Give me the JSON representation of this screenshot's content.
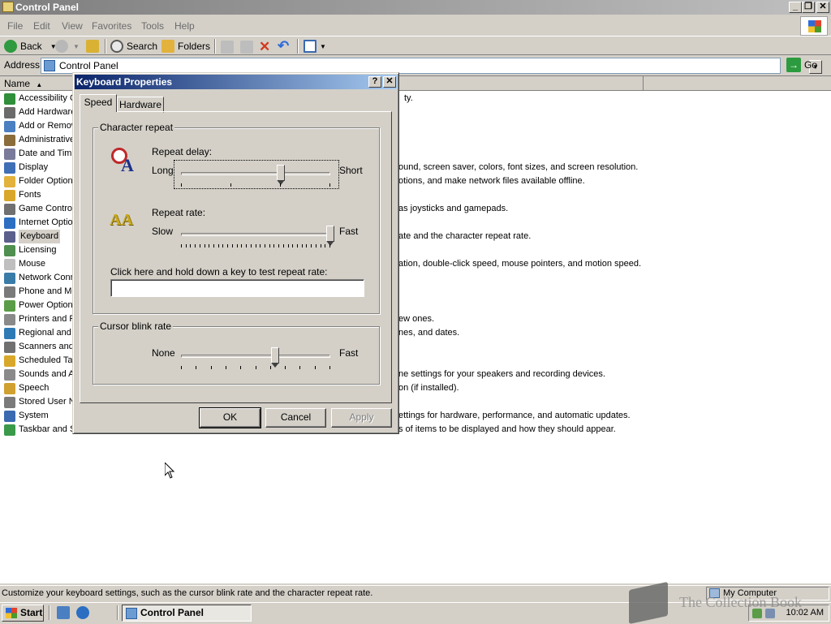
{
  "window": {
    "title": "Control Panel",
    "controls": {
      "minimize": "_",
      "maximize": "❐",
      "close": "✕"
    }
  },
  "menubar": [
    "File",
    "Edit",
    "View",
    "Favorites",
    "Tools",
    "Help"
  ],
  "toolbar": {
    "back": "Back",
    "search": "Search",
    "folders": "Folders"
  },
  "address": {
    "label": "Address",
    "value": "Control Panel",
    "go": "Go"
  },
  "columns": {
    "name": "Name"
  },
  "items": [
    {
      "label": "Accessibility O",
      "color": "#2f8f3a"
    },
    {
      "label": "Add Hardware",
      "color": "#6b6b6b"
    },
    {
      "label": "Add or Remov",
      "color": "#4a7fc1"
    },
    {
      "label": "Administrative",
      "color": "#8a6d3b"
    },
    {
      "label": "Date and Tim",
      "color": "#7a7a9a"
    },
    {
      "label": "Display",
      "color": "#3f6fb5"
    },
    {
      "label": "Folder Option",
      "color": "#e2b23c"
    },
    {
      "label": "Fonts",
      "color": "#d9a82a"
    },
    {
      "label": "Game Control",
      "color": "#707070"
    },
    {
      "label": "Internet Optio",
      "color": "#2c6fc2"
    },
    {
      "label": "Keyboard",
      "color": "#5b5f8c"
    },
    {
      "label": "Licensing",
      "color": "#4f8f4f"
    },
    {
      "label": "Mouse",
      "color": "#bfbfbf"
    },
    {
      "label": "Network Conn",
      "color": "#3a7ca8"
    },
    {
      "label": "Phone and Mo",
      "color": "#7a7a7a"
    },
    {
      "label": "Power Option",
      "color": "#5a9c47"
    },
    {
      "label": "Printers and F",
      "color": "#8a8a8a"
    },
    {
      "label": "Regional and",
      "color": "#2e7ab5"
    },
    {
      "label": "Scanners and",
      "color": "#707070"
    },
    {
      "label": "Scheduled Ta",
      "color": "#d9a82a"
    },
    {
      "label": "Sounds and A",
      "color": "#8a8a8a"
    },
    {
      "label": "Speech",
      "color": "#d0a030"
    },
    {
      "label": "Stored User N",
      "color": "#7a7a7a"
    },
    {
      "label": "System",
      "color": "#3a6ab0"
    },
    {
      "label": "Taskbar and S",
      "color": "#3a9a4a"
    }
  ],
  "descriptions": {
    "accessibility": "ty.",
    "display": "ound, screen saver, colors, font sizes, and screen resolution.",
    "folder": "otions, and make network files available offline.",
    "game": "as joysticks and gamepads.",
    "keyboard": "ate and the character repeat rate.",
    "mouse": "ation, double-click speed, mouse pointers, and motion speed.",
    "printers": "ew ones.",
    "regional": "nes, and dates.",
    "sounds": "ne settings for your speakers and recording devices.",
    "speech": "on (if installed).",
    "system": "ettings for hardware, performance, and automatic updates.",
    "taskbar": "s of items to be displayed and how they should appear."
  },
  "statusbar": {
    "text": "Customize your keyboard settings, such as the cursor blink rate and the character repeat rate.",
    "zone": "My Computer"
  },
  "taskbar": {
    "start": "Start",
    "task": "Control Panel",
    "time": "10:02 AM"
  },
  "watermark": "The Collection Book",
  "dialog": {
    "title": "Keyboard Properties",
    "help": "?",
    "close": "✕",
    "tabs": [
      "Speed",
      "Hardware"
    ],
    "character_repeat": {
      "group": "Character repeat",
      "repeat_delay": {
        "label": "Repeat delay:",
        "min": "Long",
        "max": "Short",
        "level": 0.67
      },
      "repeat_rate": {
        "label": "Repeat rate:",
        "min": "Slow",
        "max": "Fast",
        "level": 1.0
      },
      "test_label": "Click here and hold down a key to test repeat rate:",
      "test_value": ""
    },
    "cursor_blink": {
      "group": "Cursor blink rate",
      "min": "None",
      "max": "Fast",
      "level": 0.63
    },
    "buttons": {
      "ok": "OK",
      "cancel": "Cancel",
      "apply": "Apply"
    }
  }
}
